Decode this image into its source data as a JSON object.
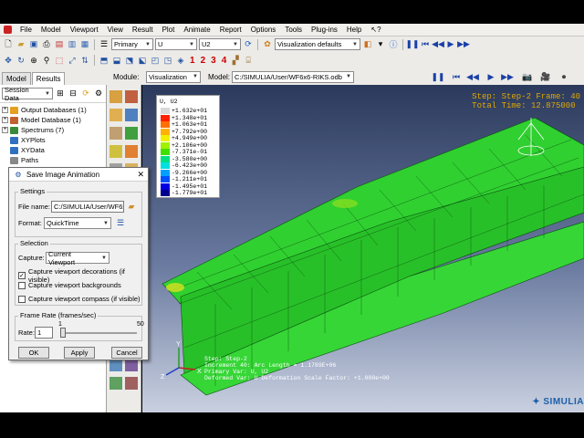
{
  "menu": [
    "File",
    "Model",
    "Viewport",
    "View",
    "Result",
    "Plot",
    "Animate",
    "Report",
    "Options",
    "Tools",
    "Plug-ins",
    "Help"
  ],
  "toolbar": {
    "primary": "Primary",
    "field": "U",
    "component": "U2",
    "viz_defaults": "Visualization defaults",
    "view_numbers": [
      "1",
      "2",
      "3",
      "4"
    ]
  },
  "context": {
    "module_label": "Module:",
    "module_value": "Visualization",
    "model_label": "Model:",
    "model_value": "C:/SIMULIA/User/WF6x6-RIKS.odb"
  },
  "left_tabs": [
    "Model",
    "Results"
  ],
  "session_data": "Session Data",
  "tree": [
    {
      "label": "Output Databases (1)",
      "color": "#e6a020"
    },
    {
      "label": "Model Database (1)",
      "color": "#c06030"
    },
    {
      "label": "Spectrums (7)",
      "color": "#3a8a3a"
    },
    {
      "label": "XYPlots",
      "color": "#3070c0"
    },
    {
      "label": "XYData",
      "color": "#3070c0"
    },
    {
      "label": "Paths",
      "color": "#888888"
    }
  ],
  "legend": {
    "title": "U, U2",
    "values": [
      "+1.632e+01",
      "+1.348e+01",
      "+1.063e+01",
      "+7.792e+00",
      "+4.949e+00",
      "+2.106e+00",
      "-7.371e-01",
      "-3.580e+00",
      "-6.423e+00",
      "-9.266e+00",
      "-1.211e+01",
      "-1.495e+01",
      "-1.779e+01"
    ],
    "colors": [
      "#d8d8d8",
      "#ff2000",
      "#ff7000",
      "#ffb000",
      "#f0f000",
      "#a0f000",
      "#40e000",
      "#00e080",
      "#00e0e0",
      "#00a0ff",
      "#0050ff",
      "#0000e0",
      "#000090"
    ]
  },
  "step_info": {
    "line1": "Step: Step-2   Frame: 40",
    "line2": "Total Time: 12.875000"
  },
  "bottom_info": [
    "Step: Step-2",
    "Increment   40: Arc Length = 1.1789E+06",
    "Primary Var: U, U2",
    "Deformed Var: U   Deformation Scale Factor: +1.000e+00"
  ],
  "brand": "SIMULIA",
  "dialog": {
    "title": "Save Image Animation",
    "settings_label": "Settings",
    "file_name_label": "File name:",
    "file_name_value": "C:/SIMULIA/User/WF6x6",
    "format_label": "Format:",
    "format_value": "QuickTime",
    "selection_label": "Selection",
    "capture_label": "Capture:",
    "capture_value": "Current Viewport",
    "opt_decorations": "Capture viewport decorations (if visible)",
    "opt_backgrounds": "Capture viewport backgrounds",
    "opt_compass": "Capture viewport compass (if visible)",
    "decorations_checked": true,
    "backgrounds_checked": false,
    "compass_checked": false,
    "frame_rate_label": "Frame Rate (frames/sec)",
    "rate_label": "Rate:",
    "rate_value": "1",
    "slider_min": "1",
    "slider_max": "50",
    "ok": "OK",
    "apply": "Apply",
    "cancel": "Cancel"
  }
}
